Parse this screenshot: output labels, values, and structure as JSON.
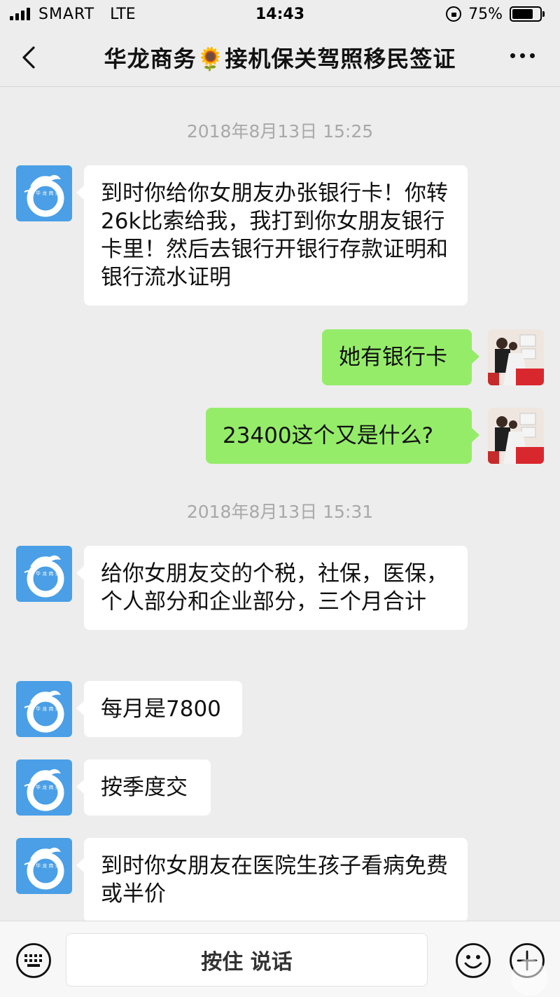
{
  "status_bar": {
    "carrier": "SMART",
    "network": "LTE",
    "time": "14:43",
    "battery": "75%",
    "battery_level": 0.75
  },
  "header": {
    "title": "华龙商务🌻接机保关驾照移民签证"
  },
  "conversation": {
    "timestamp_1": "2018年8月13日 15:25",
    "timestamp_2": "2018年8月13日 15:31",
    "msg_1": "到时你给你女朋友办张银行卡！你转26k比索给我，我打到你女朋友银行卡里！然后去银行开银行存款证明和银行流水证明",
    "msg_2": "她有银行卡",
    "msg_3": "23400这个又是什么?",
    "msg_4": "给你女朋友交的个税，社保，医保，个人部分和企业部分，三个月合计",
    "msg_5": "每月是7800",
    "msg_6": "按季度交",
    "msg_7": "到时你女朋友在医院生孩子看病免费或半价"
  },
  "input_bar": {
    "voice_label": "按住 说话"
  },
  "colors": {
    "background": "#ededed",
    "incoming_bubble": "#ffffff",
    "outgoing_bubble": "#95ec69",
    "avatar_blue": "#4a9fe6"
  }
}
